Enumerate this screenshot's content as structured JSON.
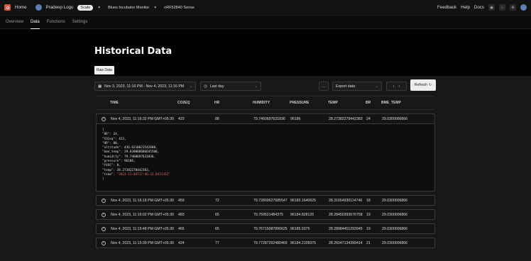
{
  "topbar": {
    "home": "Home",
    "user": "Pradeep Logu",
    "plan": "Scale",
    "project": "Blues Incubator Monitor",
    "device": "nRF52840 Sense",
    "links": [
      "Feedback",
      "Help",
      "Docs"
    ]
  },
  "tabs": [
    "Overview",
    "Data",
    "Functions",
    "Settings"
  ],
  "page_title": "Historical Data",
  "raw_tab": "Raw Data",
  "controls": {
    "date_range": "Nov 3, 2023, 11:16 PM - Nov 4, 2023, 11:16 PM",
    "preset": "Last day",
    "more": "...",
    "export": "Export data",
    "refresh": "Refresh"
  },
  "table": {
    "columns": [
      "TIME",
      "CO2EQ",
      "HR",
      "HUMIDITY",
      "PRESSURE",
      "TEMP",
      "BR",
      "BME_TEMP"
    ],
    "expanded_row": {
      "time": "Nov 4, 2023, 11:16:32 PM GMT+05:30",
      "co2eq": "423",
      "hr": "88",
      "humidity": "79.7460697631836",
      "pressure": "96186",
      "temp": "28.27382278442383",
      "br": "24",
      "bme_temp": "29.0300006866"
    },
    "json_lines": [
      {
        "k": "{",
        "v": "",
        "t": "p"
      },
      {
        "k": "  \"BR\": ",
        "v": "24,",
        "t": "n"
      },
      {
        "k": "  \"CO2eq\": ",
        "v": "423,",
        "t": "n"
      },
      {
        "k": "  \"HR\": ",
        "v": "88,",
        "t": "n"
      },
      {
        "k": "  \"altitude\": ",
        "v": "436.6210021542688,",
        "t": "n"
      },
      {
        "k": "  \"bme_temp\": ",
        "v": "29.030000686645508,",
        "t": "n"
      },
      {
        "k": "  \"humidity\": ",
        "v": "79.7460697631836,",
        "t": "n"
      },
      {
        "k": "  \"pressure\": ",
        "v": "96186,",
        "t": "n"
      },
      {
        "k": "  \"tVOC\": ",
        "v": "0,",
        "t": "n"
      },
      {
        "k": "  \"temp\": ",
        "v": "28.27382278442383,",
        "t": "n"
      },
      {
        "k": "  \"time\": ",
        "v": "\"2023-11-04T17:46:32.843135Z\"",
        "t": "s"
      },
      {
        "k": "}",
        "v": "",
        "t": "p"
      }
    ],
    "rows": [
      {
        "time": "Nov 4, 2023, 11:16:18 PM GMT+05:30",
        "co2eq": "459",
        "hr": "72",
        "humidity": "79.72899627685547",
        "pressure": "96183.1640625",
        "temp": "28.31654930114746",
        "br": "18",
        "bme_temp": "29.0300006866"
      },
      {
        "time": "Nov 4, 2023, 11:16:02 PM GMT+05:30",
        "co2eq": "483",
        "hr": "65",
        "humidity": "79.759521484375",
        "pressure": "96184.828125",
        "temp": "28.28450393676758",
        "br": "19",
        "bme_temp": "29.0300006866"
      },
      {
        "time": "Nov 4, 2023, 11:15:48 PM GMT+05:30",
        "co2eq": "465",
        "hr": "65",
        "humidity": "79.76715087890625",
        "pressure": "96185.9375",
        "temp": "28.28984451293945",
        "br": "19",
        "bme_temp": "29.0300006866"
      },
      {
        "time": "Nov 4, 2023, 11:15:39 PM GMT+05:30",
        "co2eq": "424",
        "hr": "77",
        "humidity": "79.77287292480469",
        "pressure": "96184.2109375",
        "temp": "28.26047134399414",
        "br": "21",
        "bme_temp": "29.0300006866"
      }
    ]
  }
}
